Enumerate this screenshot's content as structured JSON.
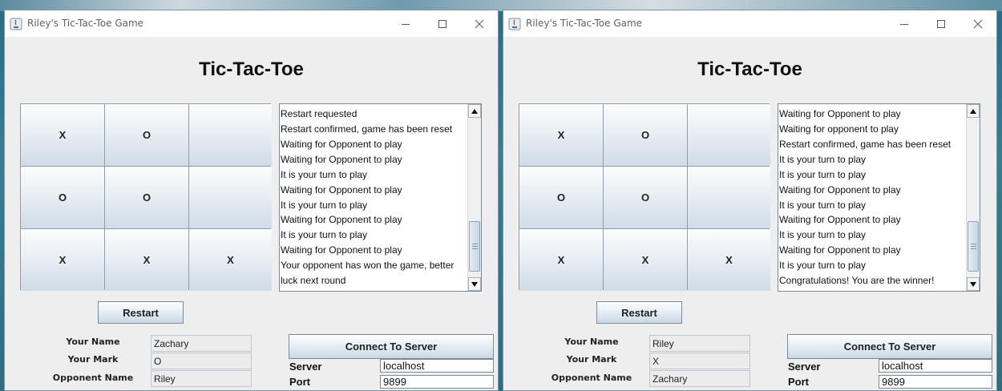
{
  "windows": [
    {
      "title": "Riley's Tic-Tac-Toe Game",
      "heading": "Tic-Tac-Toe",
      "board": [
        "X",
        "O",
        "",
        "O",
        "O",
        "",
        "X",
        "X",
        "X"
      ],
      "log": [
        "Restart requested",
        "Restart confirmed, game has been reset",
        "Waiting for Opponent to play",
        "Waiting for Opponent to play",
        "It is your turn to play",
        "Waiting for Opponent to play",
        "It is your turn to play",
        "Waiting for Opponent to play",
        "It is your turn to play",
        "Waiting for Opponent to play",
        "Your opponent has won the game, better luck next round"
      ],
      "restart_label": "Restart",
      "your_name_label": "Your Name",
      "your_name": "Zachary",
      "your_mark_label": "Your Mark",
      "your_mark": "O",
      "opponent_name_label": "Opponent Name",
      "opponent_name": "Riley",
      "connect_label": "Connect To Server",
      "server_label": "Server",
      "server": "localhost",
      "port_label": "Port",
      "port": "9899"
    },
    {
      "title": "Riley's Tic-Tac-Toe Game",
      "heading": "Tic-Tac-Toe",
      "board": [
        "X",
        "O",
        "",
        "O",
        "O",
        "",
        "X",
        "X",
        "X"
      ],
      "log": [
        "Waiting for Opponent to play",
        "Waiting for opponent to play",
        "Restart confirmed, game has been reset",
        "It is your turn to play",
        "It is your turn to play",
        "Waiting for Opponent to play",
        "It is your turn to play",
        "Waiting for Opponent to play",
        "It is your turn to play",
        "Waiting for Opponent to play",
        "It is your turn to play",
        "Congratulations! You are the winner!"
      ],
      "restart_label": "Restart",
      "your_name_label": "Your Name",
      "your_name": "Riley",
      "your_mark_label": "Your Mark",
      "your_mark": "X",
      "opponent_name_label": "Opponent Name",
      "opponent_name": "Zachary",
      "connect_label": "Connect To Server",
      "server_label": "Server",
      "server": "localhost",
      "port_label": "Port",
      "port": "9899"
    }
  ]
}
